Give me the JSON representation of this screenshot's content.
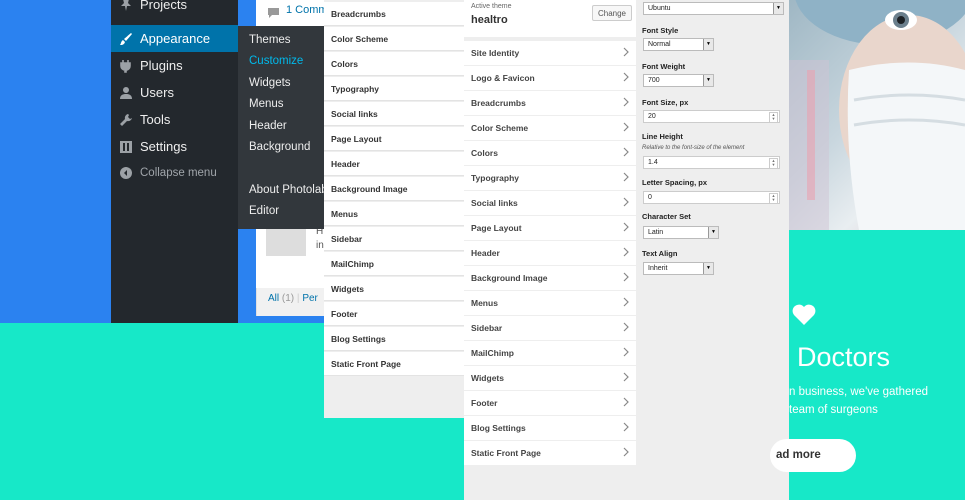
{
  "wp_menu": {
    "items": [
      {
        "label": "Projects",
        "icon": "pin-icon"
      },
      {
        "label": "Appearance",
        "icon": "brush-icon",
        "active": true
      },
      {
        "label": "Plugins",
        "icon": "plug-icon"
      },
      {
        "label": "Users",
        "icon": "user-icon"
      },
      {
        "label": "Tools",
        "icon": "wrench-icon"
      },
      {
        "label": "Settings",
        "icon": "settings-icon"
      }
    ],
    "collapse_label": "Collapse menu"
  },
  "appearance_submenu": [
    "Themes",
    "Customize",
    "Widgets",
    "Menus",
    "Header",
    "Background",
    "About Photolab",
    "Editor"
  ],
  "comments": {
    "comment_link": "1 Comm",
    "preview_text_1": "H",
    "preview_text_2": "in",
    "filter_all": "All",
    "filter_count": "(1)",
    "filter_sep": "|",
    "filter_next": "Per"
  },
  "left_sections": [
    "Breadcrumbs",
    "Color Scheme",
    "Colors",
    "Typography",
    "Social links",
    "Page Layout",
    "Header",
    "Background Image",
    "Menus",
    "Sidebar",
    "MailChimp",
    "Widgets",
    "Footer",
    "Blog Settings",
    "Static Front Page"
  ],
  "customizer": {
    "active_theme_label": "Active theme",
    "theme_name": "healtro",
    "change_button": "Change",
    "sections": [
      "Site Identity",
      "Logo & Favicon",
      "Breadcrumbs",
      "Color Scheme",
      "Colors",
      "Typography",
      "Social links",
      "Page Layout",
      "Header",
      "Background Image",
      "Menus",
      "Sidebar",
      "MailChimp",
      "Widgets",
      "Footer",
      "Blog Settings",
      "Static Front Page"
    ]
  },
  "typography_settings": {
    "font_family_value": "Ubuntu",
    "font_style_label": "Font Style",
    "font_style_value": "Normal",
    "font_weight_label": "Font Weight",
    "font_weight_value": "700",
    "font_size_label": "Font Size, px",
    "font_size_value": "20",
    "line_height_label": "Line Height",
    "line_height_desc": "Relative to the font-size of the element",
    "line_height_value": "1.4",
    "letter_spacing_label": "Letter Spacing, px",
    "letter_spacing_value": "0",
    "charset_label": "Character Set",
    "charset_value": "Latin",
    "text_align_label": "Text Align",
    "text_align_value": "Inherit"
  },
  "preview": {
    "heading": "Doctors",
    "text_line_1": "n business, we've gathered",
    "text_line_2": "team of surgeons",
    "button": "ad more"
  },
  "colors": {
    "wp_accent": "#0073aa",
    "submenu_current": "#00b9eb",
    "bg_blue": "#2b82f0",
    "bg_teal": "#17e8c8"
  }
}
